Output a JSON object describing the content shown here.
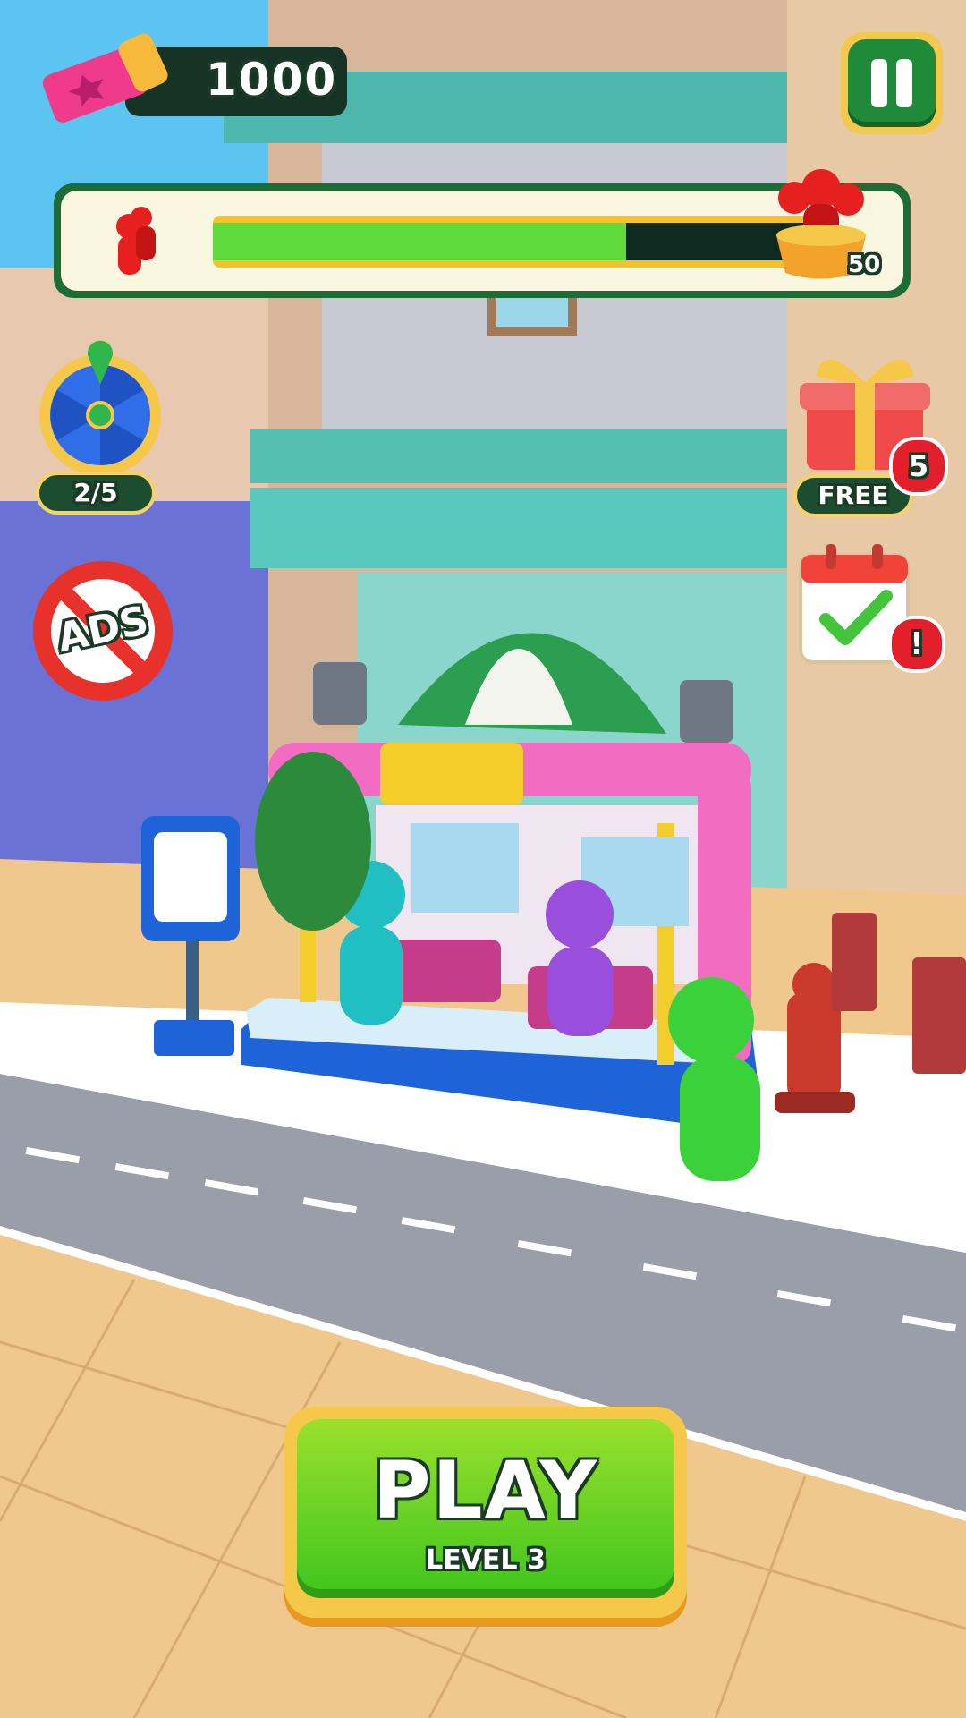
{
  "hud": {
    "tickets": "1000",
    "progress": {
      "fill_fraction": 0.66,
      "goal": "50"
    },
    "spin_wheel": {
      "count": "2/5"
    },
    "no_ads": {
      "label": "ADS"
    },
    "gift": {
      "label": "FREE",
      "badge": "5"
    },
    "daily": {
      "badge": "!"
    }
  },
  "play": {
    "label": "PLAY",
    "level": "LEVEL 3"
  },
  "colors": {
    "accent_green": "#1e8a3a",
    "play_green": "#4fcf22",
    "gold": "#f6c84a"
  }
}
